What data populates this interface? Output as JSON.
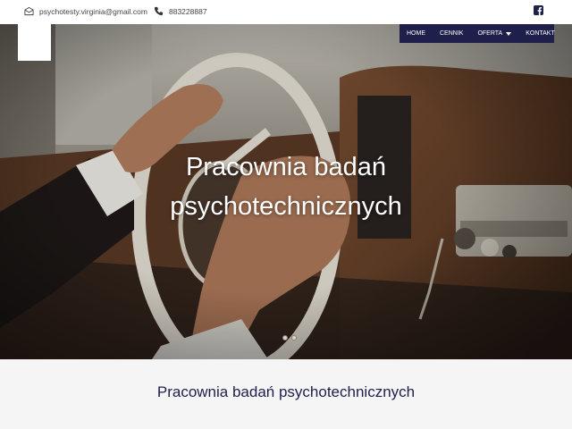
{
  "topbar": {
    "email": "psychotesty.virginia@gmail.com",
    "phone": "883228887",
    "email_icon": "envelope-icon",
    "phone_icon": "phone-icon",
    "social_icon": "facebook-icon"
  },
  "nav": {
    "items": [
      {
        "label": "HOME"
      },
      {
        "label": "CENNIK"
      },
      {
        "label": "OFERTA"
      },
      {
        "label": "KONTAKT"
      }
    ]
  },
  "hero": {
    "title_line1": "Pracownia badań",
    "title_line2": "psychotechnicznych",
    "slides": 2
  },
  "section": {
    "title": "Pracownia badań psychotechnicznych"
  },
  "colors": {
    "nav_bg": "#1e1f4b",
    "section_title": "#1e1f4b",
    "section_bg": "#f5f5f5"
  }
}
